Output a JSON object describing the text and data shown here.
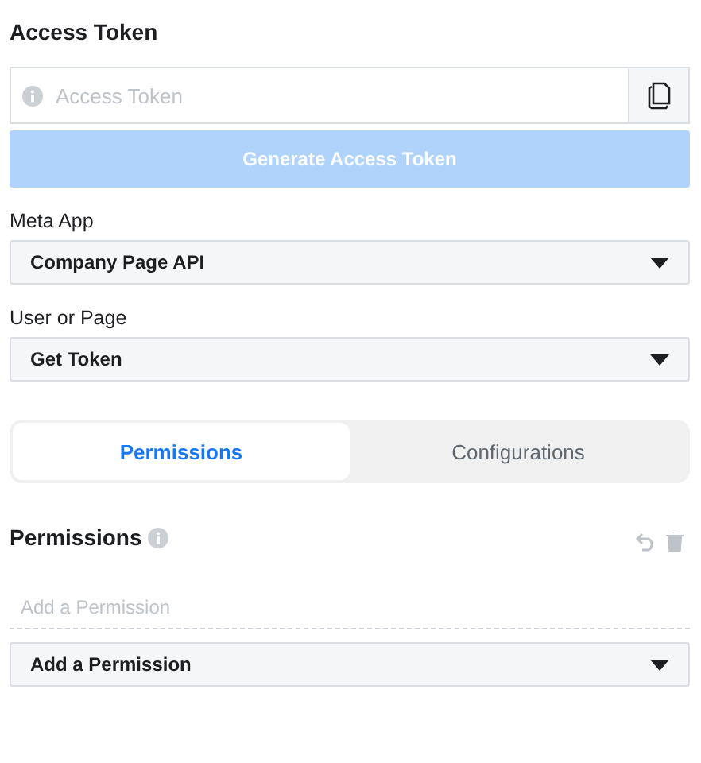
{
  "title": "Access Token",
  "token_field": {
    "placeholder": "Access Token"
  },
  "generate_button": {
    "label": "Generate Access Token",
    "disabled": true
  },
  "selects": [
    {
      "label": "Meta App",
      "value": "Company Page API"
    },
    {
      "label": "User or Page",
      "value": "Get Token"
    }
  ],
  "tabs": [
    {
      "label": "Permissions",
      "selected": true
    },
    {
      "label": "Configurations",
      "selected": false
    }
  ],
  "permissions": {
    "title": "Permissions",
    "input_placeholder": "Add a Permission",
    "select_value": "Add a Permission"
  }
}
